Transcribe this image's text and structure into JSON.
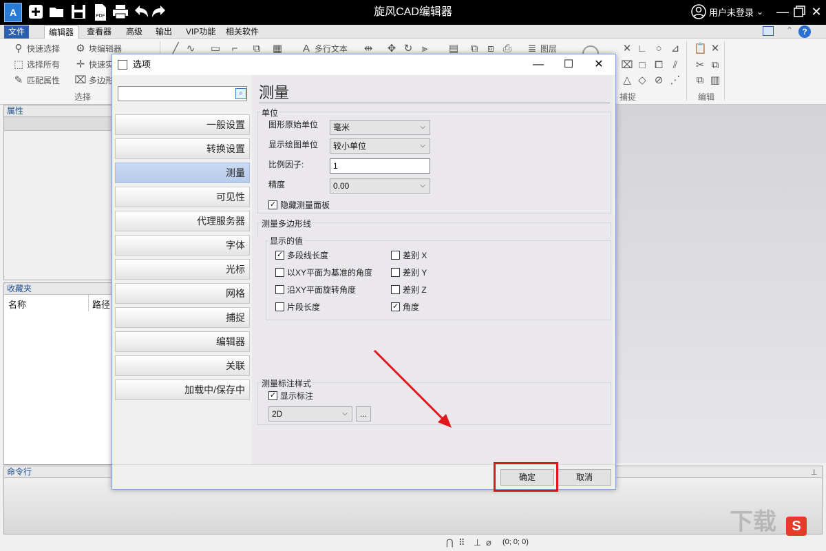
{
  "app": {
    "title": "旋风CAD编辑器",
    "logo_text": "A",
    "user_label": "用户未登录"
  },
  "menu": {
    "tabs": [
      "文件",
      "编辑器",
      "查看器",
      "高级",
      "输出",
      "VIP功能",
      "相关软件"
    ],
    "active": "编辑器"
  },
  "ribbon": {
    "select_group": {
      "items": [
        "快速选择",
        "选择所有",
        "匹配属性"
      ],
      "label": "选择"
    },
    "block_items": [
      "块编辑器",
      "快速实",
      "多边形"
    ],
    "multiline_text": "多行文本",
    "layers": "图层",
    "snap_label": "捕捉",
    "edit_label": "编辑"
  },
  "panels": {
    "properties_title": "属性",
    "favorites_title": "收藏夹",
    "favorites_columns": [
      "名称",
      "路径"
    ],
    "command_title": "命令行"
  },
  "status": {
    "coords": "(0; 0; 0)"
  },
  "dialog": {
    "title": "选项",
    "categories": [
      "一般设置",
      "转换设置",
      "测量",
      "可见性",
      "代理服务器",
      "字体",
      "光标",
      "网格",
      "捕捉",
      "编辑器",
      "关联",
      "加载中/保存中"
    ],
    "selected_category": "测量",
    "section_title": "测量",
    "units": {
      "group_label": "单位",
      "original_unit_label": "图形原始单位",
      "original_unit_value": "毫米",
      "display_unit_label": "显示绘图单位",
      "display_unit_value": "较小单位",
      "scale_label": "比例因子:",
      "scale_value": "1",
      "precision_label": "精度",
      "precision_value": "0.00",
      "hide_panel_label": "隐藏测量面板",
      "hide_panel_checked": true
    },
    "polyline": {
      "group_label": "测量多边形线",
      "display_values_label": "显示的值",
      "options": [
        {
          "label": "多段线长度",
          "checked": true
        },
        {
          "label": "以XY平面为基准的角度",
          "checked": false
        },
        {
          "label": "沿XY平面旋转角度",
          "checked": false
        },
        {
          "label": "片段长度",
          "checked": false
        }
      ],
      "options_right": [
        {
          "label": "差别 X",
          "checked": false
        },
        {
          "label": "差别 Y",
          "checked": false
        },
        {
          "label": "差别 Z",
          "checked": false
        },
        {
          "label": "角度",
          "checked": true
        }
      ]
    },
    "style": {
      "group_label": "测量标注样式",
      "show_label": "显示标注",
      "show_checked": true,
      "style_value": "2D",
      "browse_label": "..."
    },
    "ok_label": "确定",
    "cancel_label": "取消"
  },
  "colors": {
    "highlight": "#e0161c",
    "selected_category": "#c9d9f2",
    "file_tab": "#2b5fae"
  }
}
